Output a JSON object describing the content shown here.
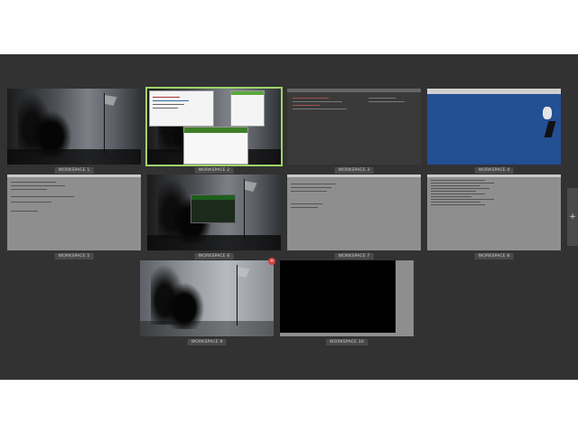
{
  "workspaces": [
    {
      "label": "WORKSPACE 1",
      "content": "wallpaper"
    },
    {
      "label": "WORKSPACE 2",
      "content": "windows",
      "active": true
    },
    {
      "label": "WORKSPACE 3",
      "content": "dark-editor"
    },
    {
      "label": "WORKSPACE 4",
      "content": "blue-desktop"
    },
    {
      "label": "WORKSPACE 5",
      "content": "code"
    },
    {
      "label": "WORKSPACE 6",
      "content": "wallpaper-terminal"
    },
    {
      "label": "WORKSPACE 7",
      "content": "code"
    },
    {
      "label": "WORKSPACE 8",
      "content": "code-dense"
    },
    {
      "label": "WORKSPACE 9",
      "content": "wallpaper"
    },
    {
      "label": "WORKSPACE 10",
      "content": "black-window"
    }
  ],
  "close_badge_glyph": "✕",
  "add_workspace_glyph": "+",
  "colors": {
    "overview_bg": "#323232",
    "active_outline": "#9fd36a",
    "close_badge": "#d94040"
  }
}
